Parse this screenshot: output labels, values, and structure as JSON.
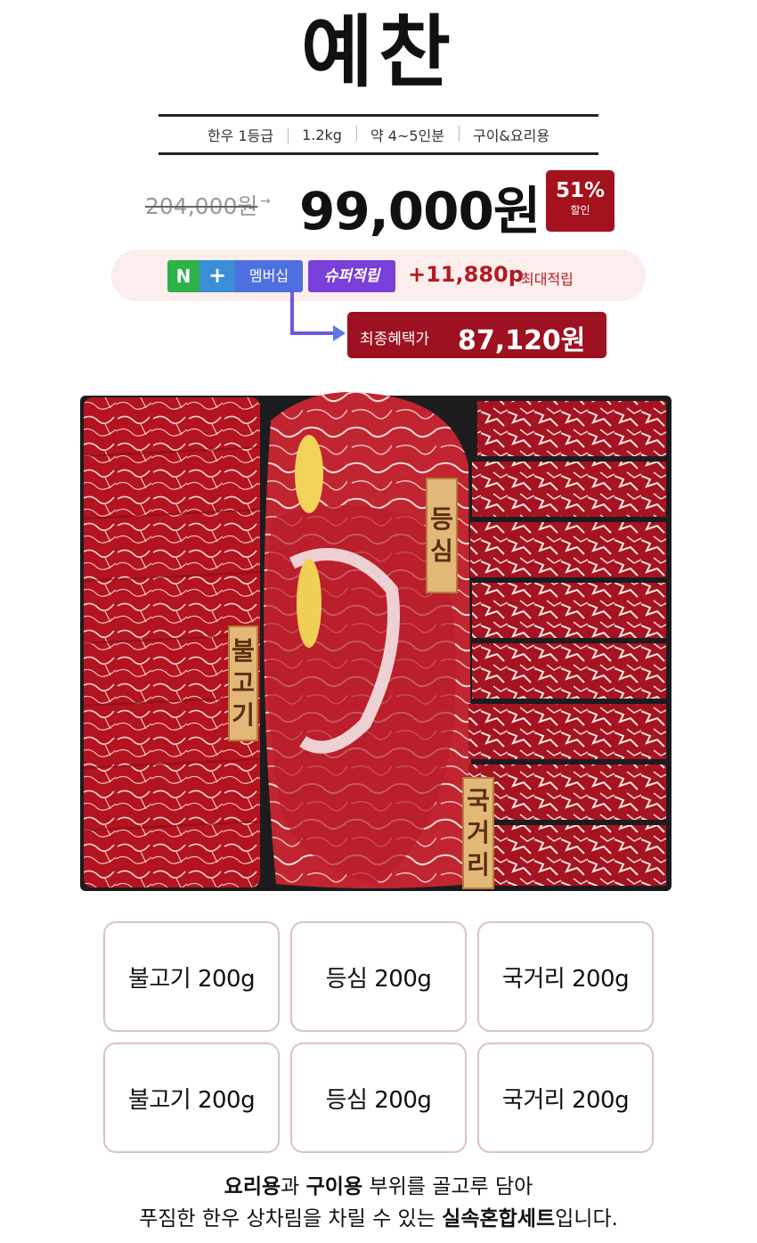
{
  "product": {
    "title": "예찬",
    "specs": [
      "한우 1등급",
      "1.2kg",
      "약 4~5인분",
      "구이&요리용"
    ]
  },
  "pricing": {
    "original_price": "204,000원",
    "sale_price": "99,000원",
    "discount_percent": "51%",
    "discount_label": "할인"
  },
  "membership": {
    "n_label": "N",
    "plus_label": "+",
    "member_label": "멤버십",
    "super_label": "슈퍼적립",
    "points": "+11,880p",
    "points_label": "최대적립",
    "final_label": "최종혜택가",
    "final_price": "87,120원"
  },
  "photo_tags": {
    "bulgogi": [
      "불",
      "고",
      "기"
    ],
    "deungsim": [
      "등",
      "심"
    ],
    "gukgeori": [
      "국",
      "거",
      "리"
    ]
  },
  "cards": [
    "불고기 200g",
    "등심 200g",
    "국거리 200g",
    "불고기 200g",
    "등심 200g",
    "국거리 200g"
  ],
  "footer": {
    "line1_bold1": "요리용",
    "line1_text1": "과 ",
    "line1_bold2": "구이용",
    "line1_text2": " 부위를 골고루 담아",
    "line2_text1": "푸짐한 한우 상차림을 차릴 수 있는 ",
    "line2_bold": "실속혼합세트",
    "line2_text2": "입니다."
  },
  "colors": {
    "accent_red": "#a3121d",
    "naver_green": "#2db34a",
    "membership_blue": "#4f6fe0",
    "super_purple": "#7a3fd8"
  }
}
